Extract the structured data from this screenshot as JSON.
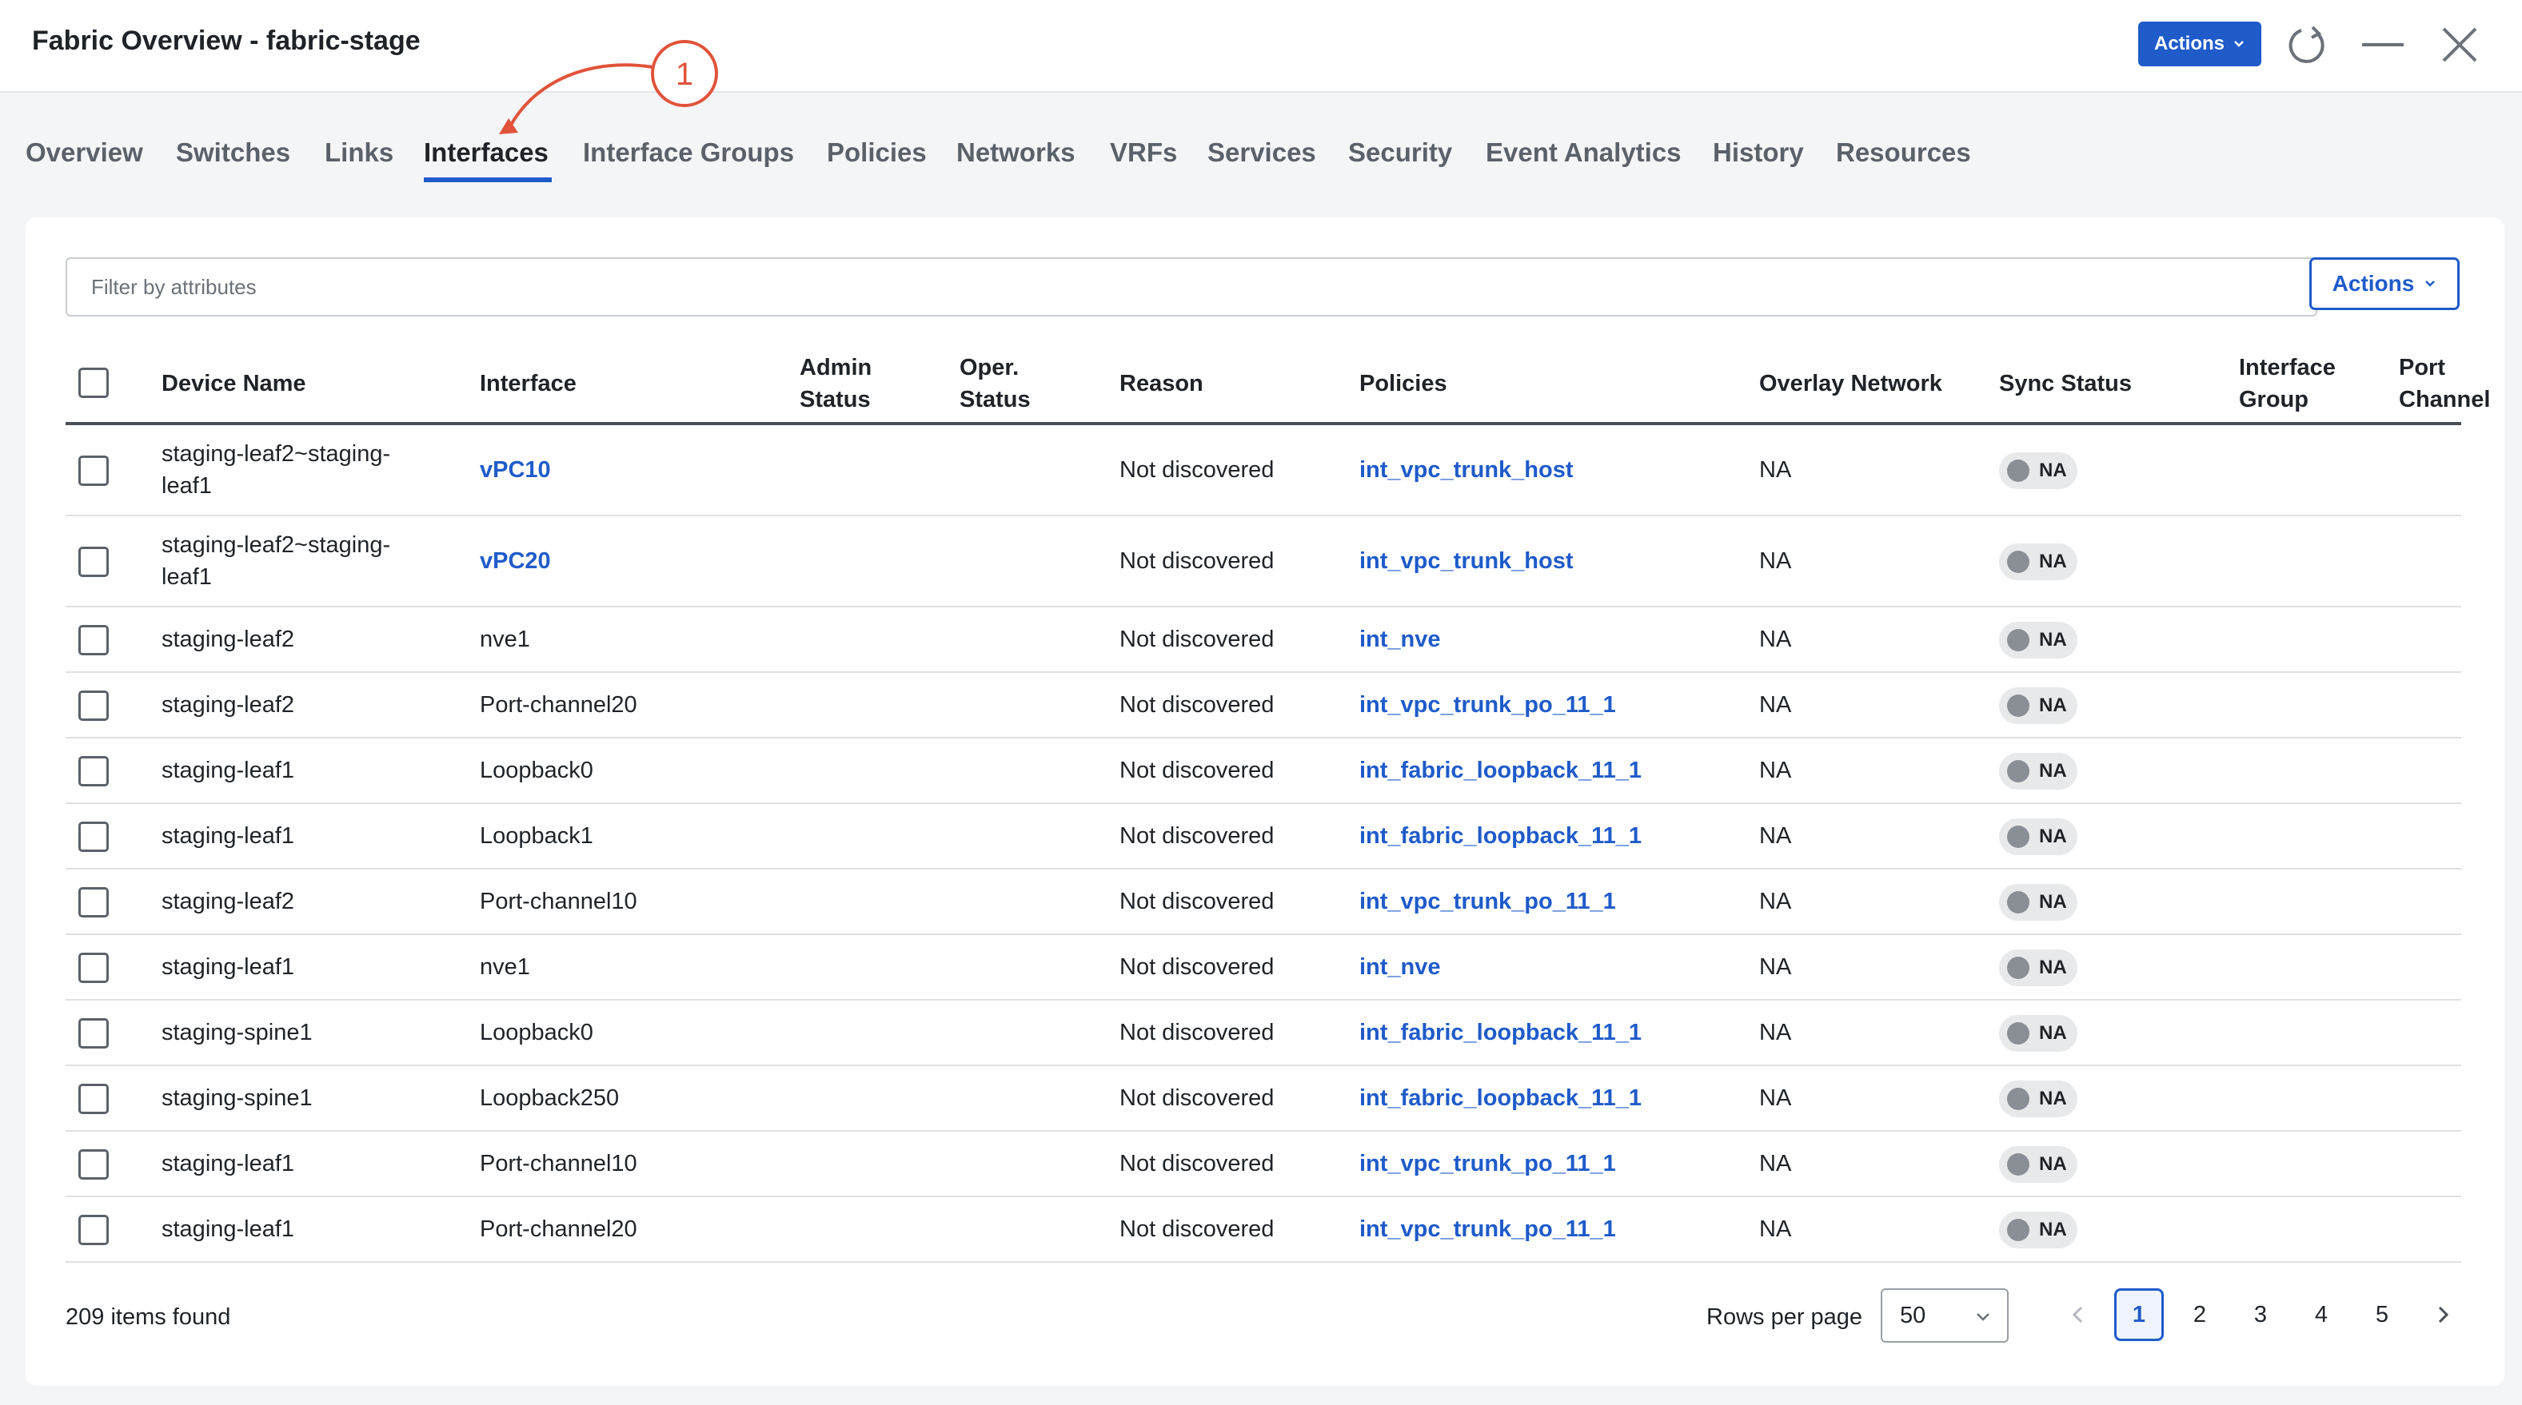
{
  "window": {
    "title": "Fabric Overview - fabric-stage",
    "actions_label": "Actions",
    "icons": [
      "chevron-down-icon",
      "refresh-icon",
      "minimize-icon",
      "close-icon"
    ]
  },
  "callout": {
    "label": "1",
    "color": "#e0533a"
  },
  "tabs": [
    {
      "label": "Overview"
    },
    {
      "label": "Switches"
    },
    {
      "label": "Links"
    },
    {
      "label": "Interfaces",
      "active": true
    },
    {
      "label": "Interface Groups"
    },
    {
      "label": "Policies"
    },
    {
      "label": "Networks"
    },
    {
      "label": "VRFs"
    },
    {
      "label": "Services"
    },
    {
      "label": "Security"
    },
    {
      "label": "Event Analytics"
    },
    {
      "label": "History"
    },
    {
      "label": "Resources"
    }
  ],
  "filter": {
    "placeholder": "Filter by attributes",
    "value": ""
  },
  "card_actions_label": "Actions",
  "table": {
    "columns": {
      "device_name": "Device Name",
      "interface": "Interface",
      "admin_status_1": "Admin",
      "admin_status_2": "Status",
      "oper_status_1": "Oper.",
      "oper_status_2": "Status",
      "reason": "Reason",
      "policies": "Policies",
      "overlay_network": "Overlay Network",
      "sync_status": "Sync Status",
      "interface_group_1": "Interface",
      "interface_group_2": "Group",
      "port_channel_1": "Port",
      "port_channel_2": "Channel"
    },
    "rows": [
      {
        "device_1": "staging-leaf2~staging-",
        "device_2": "leaf1",
        "interface": "vPC10",
        "interface_link": true,
        "admin_status": "",
        "oper_status": "",
        "reason": "Not discovered",
        "policy": "int_vpc_trunk_host",
        "overlay": "NA",
        "sync": "NA"
      },
      {
        "device_1": "staging-leaf2~staging-",
        "device_2": "leaf1",
        "interface": "vPC20",
        "interface_link": true,
        "admin_status": "",
        "oper_status": "",
        "reason": "Not discovered",
        "policy": "int_vpc_trunk_host",
        "overlay": "NA",
        "sync": "NA"
      },
      {
        "device_1": "staging-leaf2",
        "device_2": "",
        "interface": "nve1",
        "interface_link": false,
        "admin_status": "",
        "oper_status": "",
        "reason": "Not discovered",
        "policy": "int_nve",
        "overlay": "NA",
        "sync": "NA"
      },
      {
        "device_1": "staging-leaf2",
        "device_2": "",
        "interface": "Port-channel20",
        "interface_link": false,
        "admin_status": "",
        "oper_status": "",
        "reason": "Not discovered",
        "policy": "int_vpc_trunk_po_11_1",
        "overlay": "NA",
        "sync": "NA"
      },
      {
        "device_1": "staging-leaf1",
        "device_2": "",
        "interface": "Loopback0",
        "interface_link": false,
        "admin_status": "",
        "oper_status": "",
        "reason": "Not discovered",
        "policy": "int_fabric_loopback_11_1",
        "overlay": "NA",
        "sync": "NA"
      },
      {
        "device_1": "staging-leaf1",
        "device_2": "",
        "interface": "Loopback1",
        "interface_link": false,
        "admin_status": "",
        "oper_status": "",
        "reason": "Not discovered",
        "policy": "int_fabric_loopback_11_1",
        "overlay": "NA",
        "sync": "NA"
      },
      {
        "device_1": "staging-leaf2",
        "device_2": "",
        "interface": "Port-channel10",
        "interface_link": false,
        "admin_status": "",
        "oper_status": "",
        "reason": "Not discovered",
        "policy": "int_vpc_trunk_po_11_1",
        "overlay": "NA",
        "sync": "NA"
      },
      {
        "device_1": "staging-leaf1",
        "device_2": "",
        "interface": "nve1",
        "interface_link": false,
        "admin_status": "",
        "oper_status": "",
        "reason": "Not discovered",
        "policy": "int_nve",
        "overlay": "NA",
        "sync": "NA"
      },
      {
        "device_1": "staging-spine1",
        "device_2": "",
        "interface": "Loopback0",
        "interface_link": false,
        "admin_status": "",
        "oper_status": "",
        "reason": "Not discovered",
        "policy": "int_fabric_loopback_11_1",
        "overlay": "NA",
        "sync": "NA"
      },
      {
        "device_1": "staging-spine1",
        "device_2": "",
        "interface": "Loopback250",
        "interface_link": false,
        "admin_status": "",
        "oper_status": "",
        "reason": "Not discovered",
        "policy": "int_fabric_loopback_11_1",
        "overlay": "NA",
        "sync": "NA"
      },
      {
        "device_1": "staging-leaf1",
        "device_2": "",
        "interface": "Port-channel10",
        "interface_link": false,
        "admin_status": "",
        "oper_status": "",
        "reason": "Not discovered",
        "policy": "int_vpc_trunk_po_11_1",
        "overlay": "NA",
        "sync": "NA"
      },
      {
        "device_1": "staging-leaf1",
        "device_2": "",
        "interface": "Port-channel20",
        "interface_link": false,
        "admin_status": "",
        "oper_status": "",
        "reason": "Not discovered",
        "policy": "int_vpc_trunk_po_11_1",
        "overlay": "NA",
        "sync": "NA"
      }
    ]
  },
  "footer": {
    "items_found": "209 items found",
    "rows_per_page_label": "Rows per page",
    "rows_per_page_value": "50",
    "pages": [
      "1",
      "2",
      "3",
      "4",
      "5"
    ],
    "current_page": "1"
  },
  "colors": {
    "accent": "#1f5bc9",
    "callout": "#e0533a",
    "sync_dot": "#8a8f96"
  }
}
